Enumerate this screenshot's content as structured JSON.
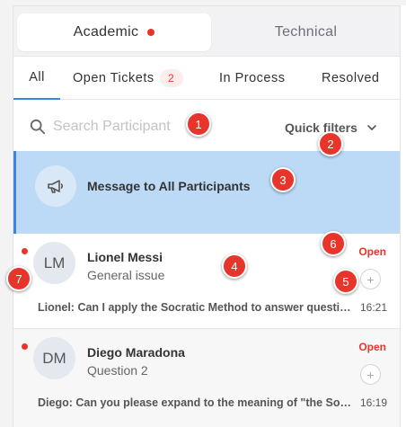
{
  "category_tabs": [
    {
      "label": "Academic",
      "active": true,
      "has_unread": true
    },
    {
      "label": "Technical",
      "active": false
    }
  ],
  "status_tabs": {
    "all": "All",
    "open": "Open Tickets",
    "open_count": "2",
    "in_process": "In Process",
    "resolved": "Resolved"
  },
  "search": {
    "placeholder": "Search Participant",
    "value": ""
  },
  "quick_filters": {
    "label": "Quick filters"
  },
  "broadcast": {
    "label": "Message to All Participants",
    "icon": "megaphone-icon"
  },
  "tickets": [
    {
      "initials": "LM",
      "name": "Lionel Messi",
      "subject": "General issue",
      "status": "Open",
      "preview": "Lionel: Can I apply the Socratic Method to answer questions in class?",
      "time": "16:21",
      "unread": true
    },
    {
      "initials": "DM",
      "name": "Diego Maradona",
      "subject": "Question 2",
      "status": "Open",
      "preview": "Diego: Can you please expand to the meaning of \"the Socratic Method\"?",
      "time": "16:19",
      "unread": true
    }
  ],
  "annotations": [
    "1",
    "2",
    "3",
    "4",
    "5",
    "6",
    "7"
  ],
  "colors": {
    "accent": "#3a86e8",
    "alert": "#e8352b",
    "selected_row": "#bcdaf6",
    "badge_bg": "#fdecec"
  }
}
